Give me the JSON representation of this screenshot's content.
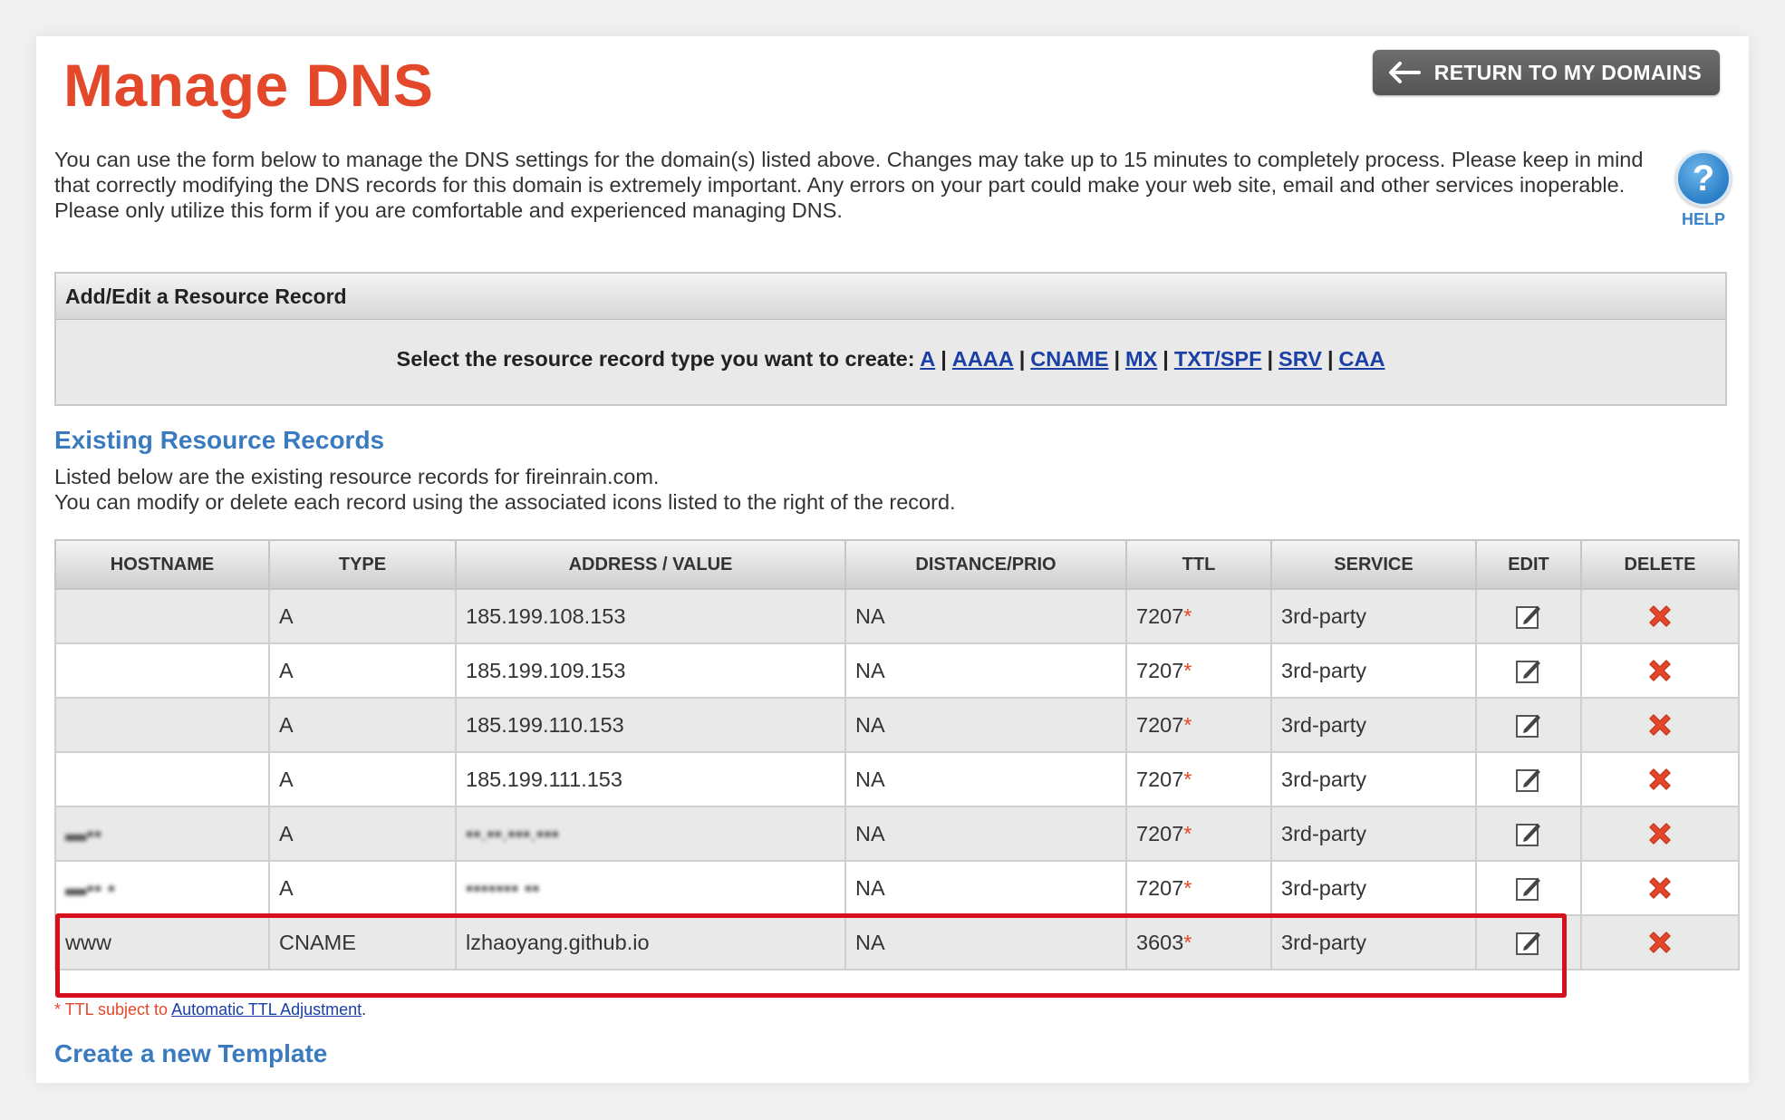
{
  "page": {
    "title": "Manage DNS",
    "return_button": "RETURN TO MY DOMAINS",
    "intro": "You can use the form below to manage the DNS settings for the domain(s) listed above. Changes may take up to 15 minutes to completely process. Please keep in mind that correctly modifying the DNS records for this domain is extremely important. Any errors on your part could make your web site, email and other services inoperable. Please only utilize this form if you are comfortable and experienced managing DNS.",
    "help_label": "HELP"
  },
  "add_edit": {
    "heading": "Add/Edit a Resource Record",
    "prompt": "Select the resource record type you want to create:",
    "types": [
      "A",
      "AAAA",
      "CNAME",
      "MX",
      "TXT/SPF",
      "SRV",
      "CAA"
    ]
  },
  "existing": {
    "title": "Existing Resource Records",
    "line1": "Listed below are the existing resource records for fireinrain.com.",
    "line2": "You can modify or delete each record using the associated icons listed to the right of the record.",
    "columns": [
      "HOSTNAME",
      "TYPE",
      "ADDRESS / VALUE",
      "DISTANCE/PRIO",
      "TTL",
      "SERVICE",
      "EDIT",
      "DELETE"
    ],
    "records": [
      {
        "hostname": "",
        "type": "A",
        "value": "185.199.108.153",
        "prio": "NA",
        "ttl": "7207",
        "service": "3rd-party"
      },
      {
        "hostname": "",
        "type": "A",
        "value": "185.199.109.153",
        "prio": "NA",
        "ttl": "7207",
        "service": "3rd-party"
      },
      {
        "hostname": "",
        "type": "A",
        "value": "185.199.110.153",
        "prio": "NA",
        "ttl": "7207",
        "service": "3rd-party"
      },
      {
        "hostname": "",
        "type": "A",
        "value": "185.199.111.153",
        "prio": "NA",
        "ttl": "7207",
        "service": "3rd-party"
      },
      {
        "hostname": "▬▪▪",
        "type": "A",
        "value": "▪▪.▪▪.▪▪▪.▪▪▪",
        "prio": "NA",
        "ttl": "7207",
        "service": "3rd-party",
        "blurred": true
      },
      {
        "hostname": "▬▪▪ ▪",
        "type": "A",
        "value": "▪▪▪▪▪▪▪ ▪▪",
        "prio": "NA",
        "ttl": "7207",
        "service": "3rd-party",
        "blurred": true
      },
      {
        "hostname": "www",
        "type": "CNAME",
        "value": "lzhaoyang.github.io",
        "prio": "NA",
        "ttl": "3603",
        "service": "3rd-party"
      }
    ],
    "ttl_star": "*"
  },
  "footer": {
    "ttl_note_prefix": "* TTL subject to ",
    "ttl_note_link": "Automatic TTL Adjustment",
    "ttl_note_suffix": ".",
    "create_template": "Create a new Template"
  },
  "icons": {
    "back": "arrow-left-icon",
    "help": "question-icon",
    "edit": "edit-pencil-icon",
    "delete": "delete-x-icon"
  },
  "colors": {
    "title": "#e4482a",
    "section": "#3a7bc0",
    "link": "#1a3fa6",
    "highlight": "#d6101c",
    "delete": "#e8452c"
  }
}
